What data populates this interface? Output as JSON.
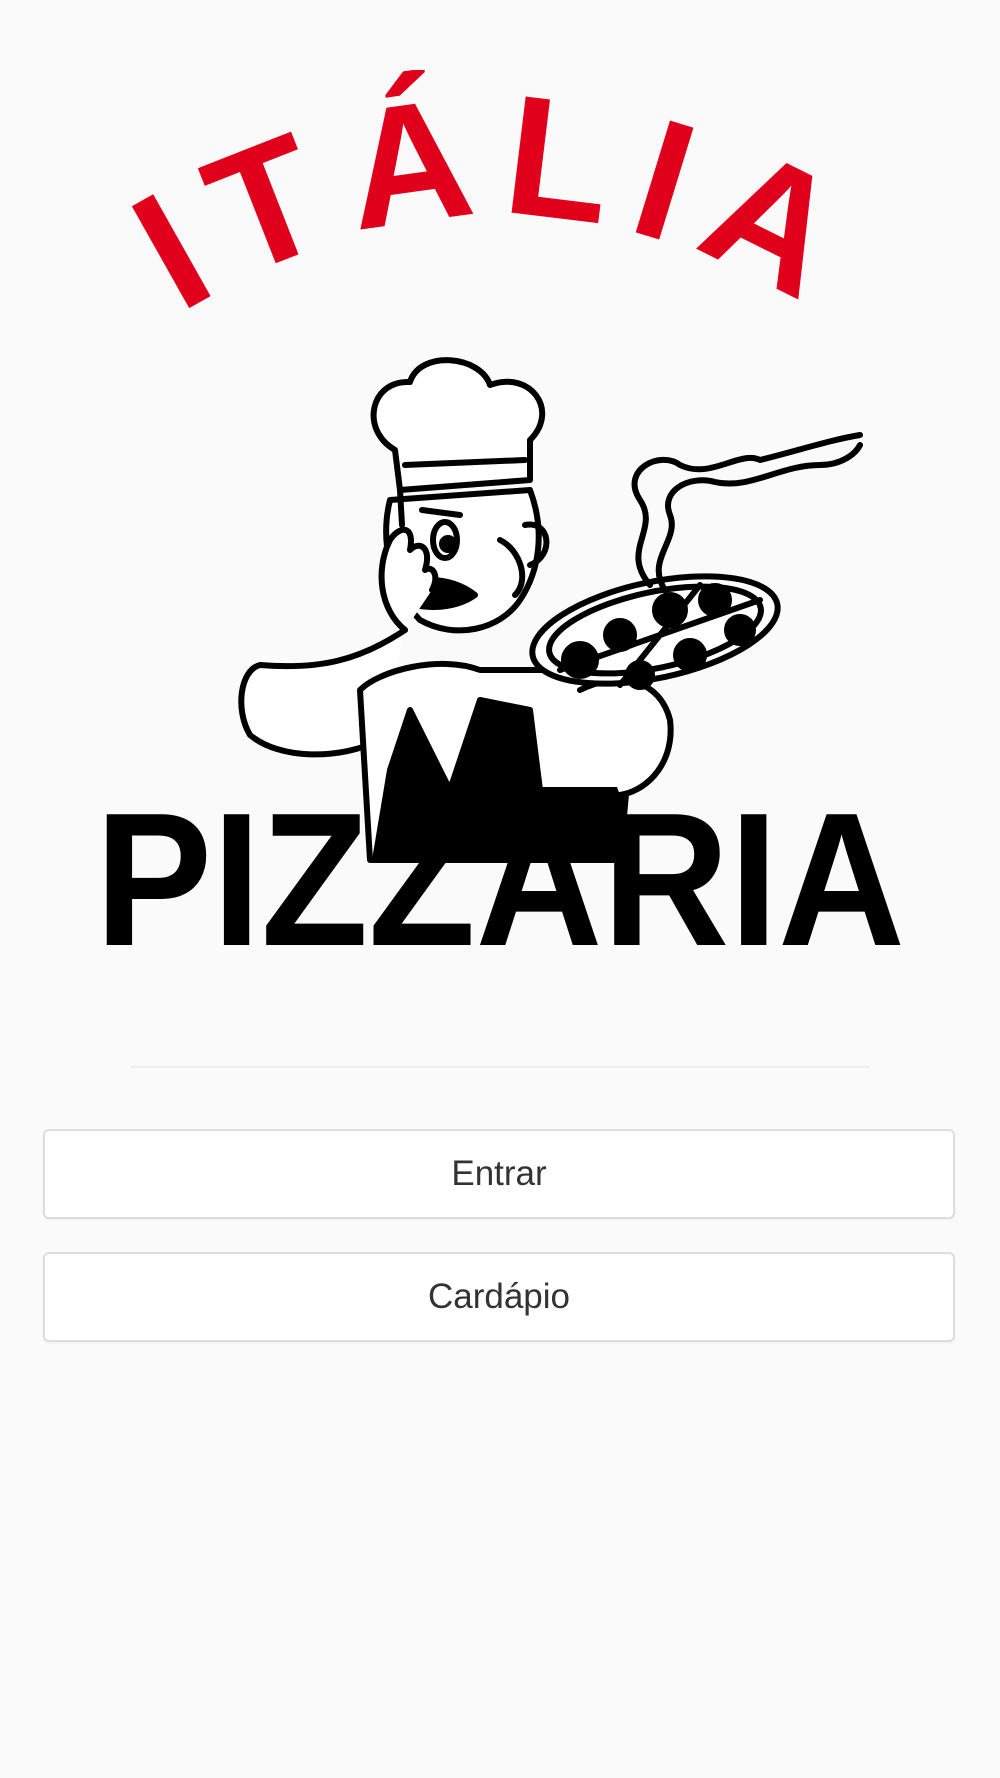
{
  "logo": {
    "top_text": "ITÁLIA",
    "bottom_text": "PIZZARIA",
    "top_color": "#e0001b",
    "bottom_color": "#000000",
    "illustration": "chef-with-pizza"
  },
  "actions": {
    "entrar_label": "Entrar",
    "cardapio_label": "Cardápio"
  }
}
